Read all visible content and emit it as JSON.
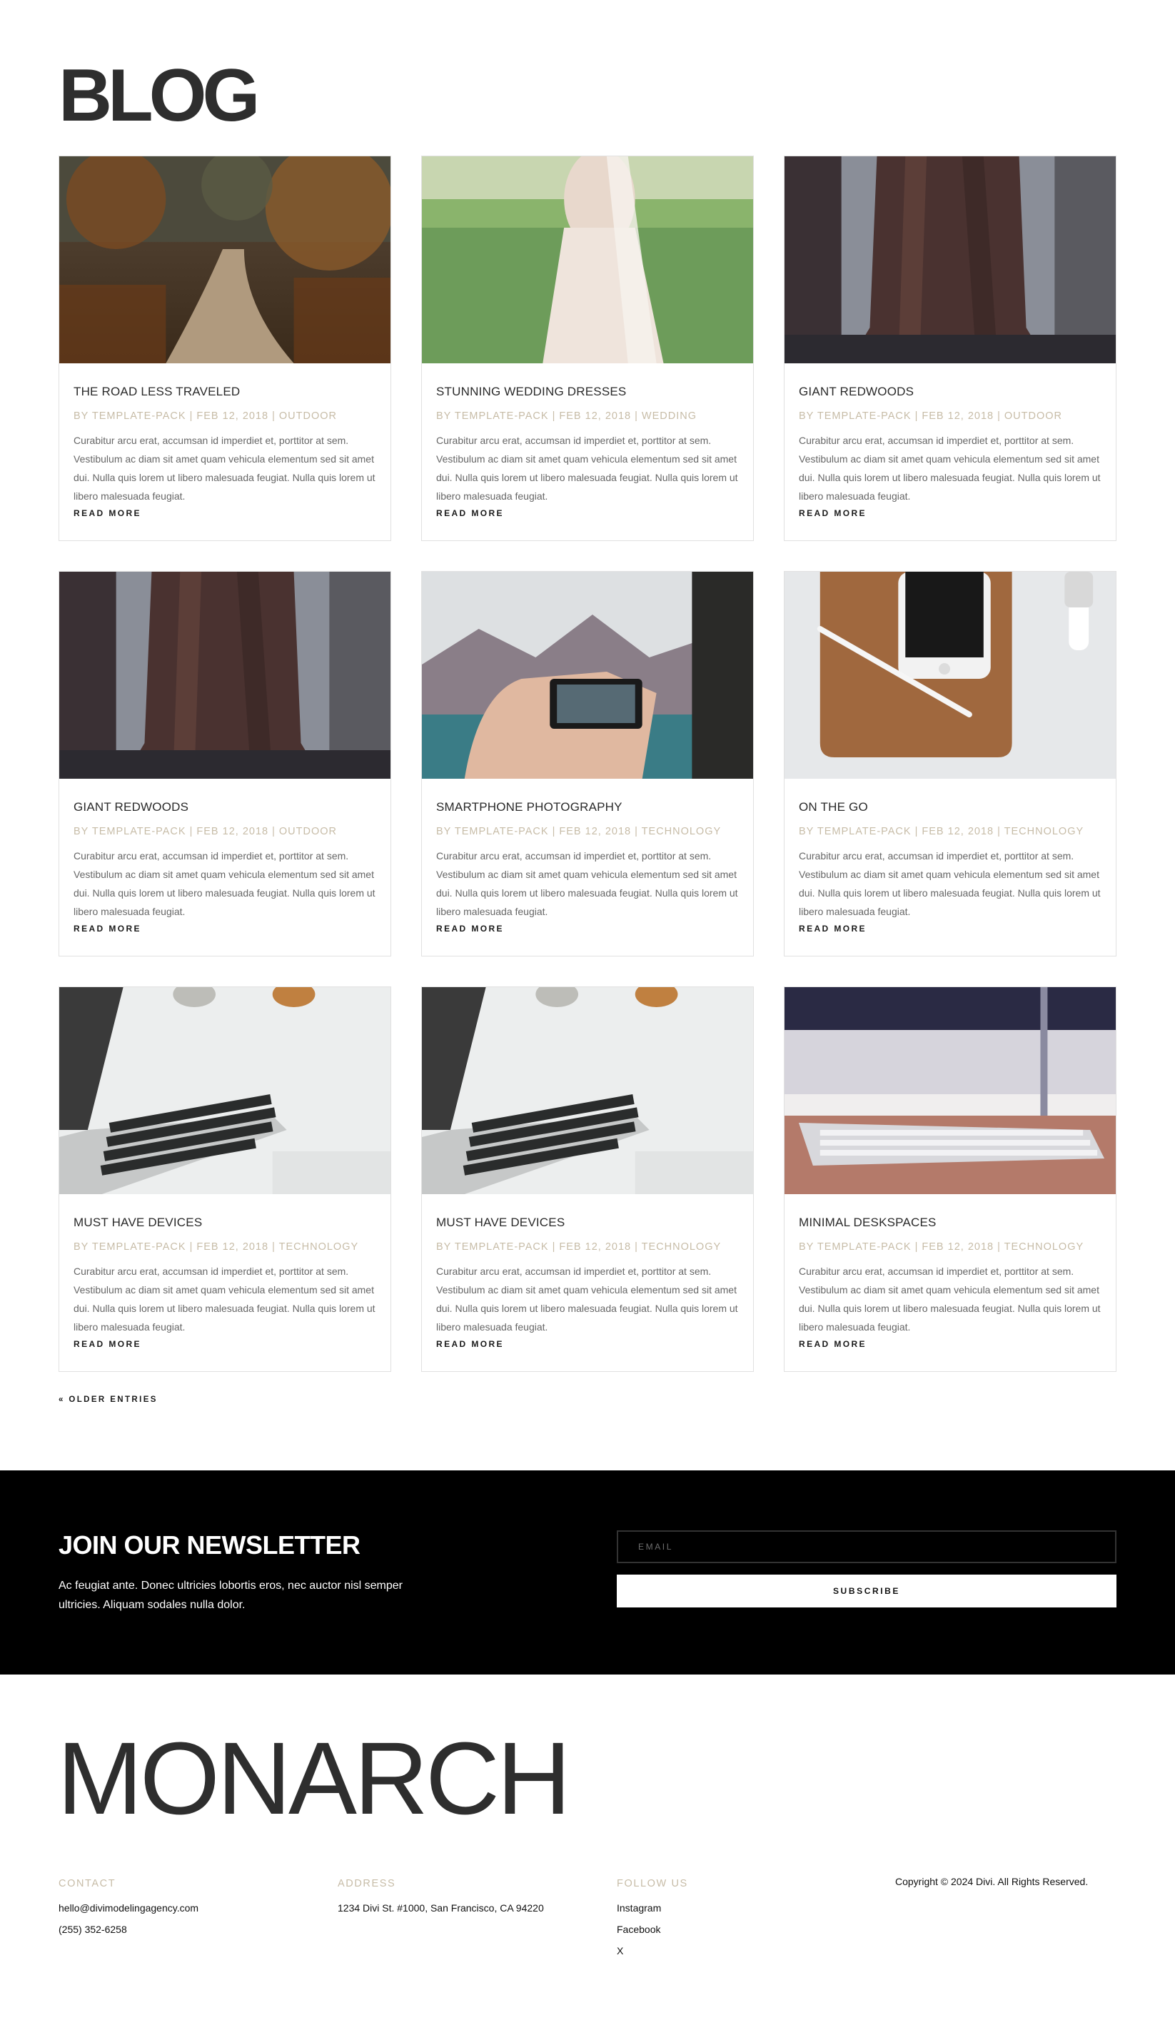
{
  "blog": {
    "title": "BLOG"
  },
  "posts": [
    {
      "title": "THE ROAD LESS TRAVELED",
      "author": "TEMPLATE-PACK",
      "date": "FEB 12, 2018",
      "category": "OUTDOOR",
      "image": "forest-path",
      "excerpt": "Curabitur arcu erat, accumsan id imperdiet et, porttitor at sem. Vestibulum ac diam sit amet quam vehicula elementum sed sit amet dui. Nulla quis lorem ut libero malesuada feugiat. Nulla quis lorem ut libero malesuada feugiat.",
      "read_more": "READ MORE"
    },
    {
      "title": "STUNNING WEDDING DRESSES",
      "author": "TEMPLATE-PACK",
      "date": "FEB 12, 2018",
      "category": "WEDDING",
      "image": "wedding-dress",
      "excerpt": "Curabitur arcu erat, accumsan id imperdiet et, porttitor at sem. Vestibulum ac diam sit amet quam vehicula elementum sed sit amet dui. Nulla quis lorem ut libero malesuada feugiat. Nulla quis lorem ut libero malesuada feugiat.",
      "read_more": "READ MORE"
    },
    {
      "title": "GIANT REDWOODS",
      "author": "TEMPLATE-PACK",
      "date": "FEB 12, 2018",
      "category": "OUTDOOR",
      "image": "redwood-trunk",
      "excerpt": "Curabitur arcu erat, accumsan id imperdiet et, porttitor at sem. Vestibulum ac diam sit amet quam vehicula elementum sed sit amet dui. Nulla quis lorem ut libero malesuada feugiat. Nulla quis lorem ut libero malesuada feugiat.",
      "read_more": "READ MORE"
    },
    {
      "title": "GIANT REDWOODS",
      "author": "TEMPLATE-PACK",
      "date": "FEB 12, 2018",
      "category": "OUTDOOR",
      "image": "redwood-trunk",
      "excerpt": "Curabitur arcu erat, accumsan id imperdiet et, porttitor at sem. Vestibulum ac diam sit amet quam vehicula elementum sed sit amet dui. Nulla quis lorem ut libero malesuada feugiat. Nulla quis lorem ut libero malesuada feugiat.",
      "read_more": "READ MORE"
    },
    {
      "title": "SMARTPHONE PHOTOGRAPHY",
      "author": "TEMPLATE-PACK",
      "date": "FEB 12, 2018",
      "category": "TECHNOLOGY",
      "image": "phone-photo",
      "excerpt": "Curabitur arcu erat, accumsan id imperdiet et, porttitor at sem. Vestibulum ac diam sit amet quam vehicula elementum sed sit amet dui. Nulla quis lorem ut libero malesuada feugiat. Nulla quis lorem ut libero malesuada feugiat.",
      "read_more": "READ MORE"
    },
    {
      "title": "ON THE GO",
      "author": "TEMPLATE-PACK",
      "date": "FEB 12, 2018",
      "category": "TECHNOLOGY",
      "image": "desk-gadgets",
      "excerpt": "Curabitur arcu erat, accumsan id imperdiet et, porttitor at sem. Vestibulum ac diam sit amet quam vehicula elementum sed sit amet dui. Nulla quis lorem ut libero malesuada feugiat. Nulla quis lorem ut libero malesuada feugiat.",
      "read_more": "READ MORE"
    },
    {
      "title": "MUST HAVE DEVICES",
      "author": "TEMPLATE-PACK",
      "date": "FEB 12, 2018",
      "category": "TECHNOLOGY",
      "image": "laptop-keyboard",
      "excerpt": "Curabitur arcu erat, accumsan id imperdiet et, porttitor at sem. Vestibulum ac diam sit amet quam vehicula elementum sed sit amet dui. Nulla quis lorem ut libero malesuada feugiat. Nulla quis lorem ut libero malesuada feugiat.",
      "read_more": "READ MORE"
    },
    {
      "title": "MUST HAVE DEVICES",
      "author": "TEMPLATE-PACK",
      "date": "FEB 12, 2018",
      "category": "TECHNOLOGY",
      "image": "laptop-keyboard",
      "excerpt": "Curabitur arcu erat, accumsan id imperdiet et, porttitor at sem. Vestibulum ac diam sit amet quam vehicula elementum sed sit amet dui. Nulla quis lorem ut libero malesuada feugiat. Nulla quis lorem ut libero malesuada feugiat.",
      "read_more": "READ MORE"
    },
    {
      "title": "MINIMAL DESKSPACES",
      "author": "TEMPLATE-PACK",
      "date": "FEB 12, 2018",
      "category": "TECHNOLOGY",
      "image": "desk-keyboard",
      "excerpt": "Curabitur arcu erat, accumsan id imperdiet et, porttitor at sem. Vestibulum ac diam sit amet quam vehicula elementum sed sit amet dui. Nulla quis lorem ut libero malesuada feugiat. Nulla quis lorem ut libero malesuada feugiat.",
      "read_more": "READ MORE"
    }
  ],
  "pagination": {
    "older_entries": "« OLDER ENTRIES"
  },
  "newsletter": {
    "title": "JOIN OUR NEWSLETTER",
    "text": "Ac feugiat ante. Donec ultricies lobortis eros, nec auctor nisl semper ultricies. Aliquam sodales nulla dolor.",
    "email_placeholder": "EMAIL",
    "subscribe_label": "SUBSCRIBE"
  },
  "footer": {
    "brand": "MONARCH",
    "contact": {
      "heading": "CONTACT",
      "email": "hello@divimodelingagency.com",
      "phone": "(255) 352-6258"
    },
    "address": {
      "heading": "ADDRESS",
      "line": "1234 Divi St. #1000, San Francisco, CA 94220"
    },
    "follow": {
      "heading": "FOLLOW US",
      "links": [
        "Instagram",
        "Facebook",
        "X"
      ]
    },
    "copyright": "Copyright © 2024 Divi. All Rights Reserved."
  },
  "colors": {
    "meta": "#c7bca7",
    "newsletter_bg": "#000000",
    "heading": "#2e2e2e"
  }
}
